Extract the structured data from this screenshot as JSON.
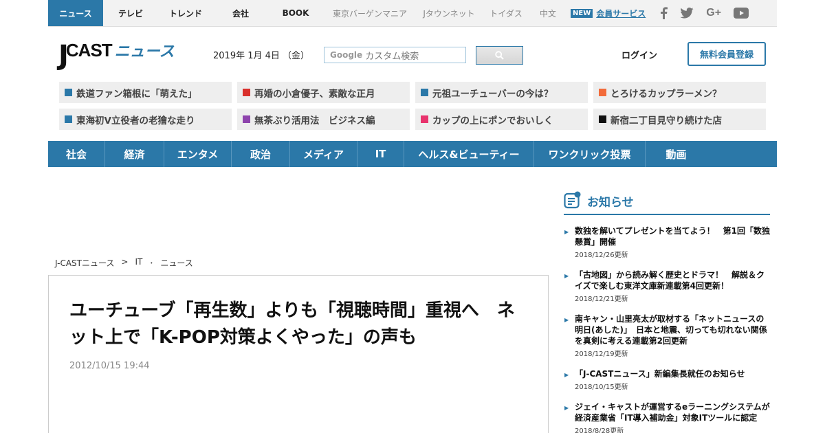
{
  "topbar": {
    "news": "ニュース",
    "tv": "テレビ",
    "trend": "トレンド",
    "company": "会社",
    "book": "BOOK",
    "bargain": "東京バーゲンマニア",
    "jtown": "Jタウンネット",
    "toidas": "トイダス",
    "chinese": "中文",
    "new_badge": "NEW",
    "member": "会員サービス"
  },
  "header": {
    "logo_j": "J",
    "logo_cast": "CAST",
    "logo_news": "ニュース",
    "date": "2019年 1月 4日 （金）",
    "search_brand": "Google",
    "search_placeholder": "カスタム検索",
    "login": "ログイン",
    "register": "無料会員登録"
  },
  "pickups": [
    {
      "text": "鉄道ファン箱根に「萌えた」",
      "color": "#2b78a8"
    },
    {
      "text": "再婚の小倉優子、素敵な正月",
      "color": "#d9302c"
    },
    {
      "text": "元祖ユーチューバーの今は？",
      "color": "#2b78a8"
    },
    {
      "text": "とろけるカップラーメン？",
      "color": "#f26b3a"
    },
    {
      "text": "東海初V立役者の老獪な走り",
      "color": "#2b78a8"
    },
    {
      "text": "無茶ぶり活用法　ビジネス編",
      "color": "#8e44ad"
    },
    {
      "text": "カップの上にポンでおいしく",
      "color": "#e8336d"
    },
    {
      "text": "新宿二丁目見守り続けた店",
      "color": "#111111"
    }
  ],
  "nav": [
    "社会",
    "経済",
    "エンタメ",
    "政治",
    "メディア",
    "IT",
    "ヘルス&ビューティー",
    "ワンクリック投票",
    "動画"
  ],
  "breadcrumb": {
    "root": "J-CASTニュース",
    "sep": ">",
    "cat": "IT",
    "dot": "･",
    "sub": "ニュース"
  },
  "article": {
    "headline": "ユーチューブ「再生数」よりも「視聴時間」重視へ　ネット上で「K-POP対策よくやった」の声も",
    "date": "2012/10/15 19:44"
  },
  "sidebar": {
    "title": "お知らせ",
    "notices": [
      {
        "text": "数独を解いてプレゼントを当てよう！　第1回「数独懸賞」開催",
        "date": "2018/12/26更新"
      },
      {
        "text": "「古地図」から読み解く歴史とドラマ！　解説＆クイズで楽しむ東洋文庫新連載第4回更新！",
        "date": "2018/12/21更新"
      },
      {
        "text": "南キャン・山里亮太が取材する「ネットニュースの明日(あした)」　日本と地震、切っても切れない関係を真剣に考える連載第2回更新",
        "date": "2018/12/19更新"
      },
      {
        "text": "「J-CASTニュース」新編集長就任のお知らせ",
        "date": "2018/10/15更新"
      },
      {
        "text": "ジェイ・キャストが運営するeラーニングシステムが経済産業省「IT導入補助金」対象ITツールに認定",
        "date": "2018/8/28更新"
      }
    ]
  },
  "colors": {
    "accent": "#2b78a8"
  }
}
